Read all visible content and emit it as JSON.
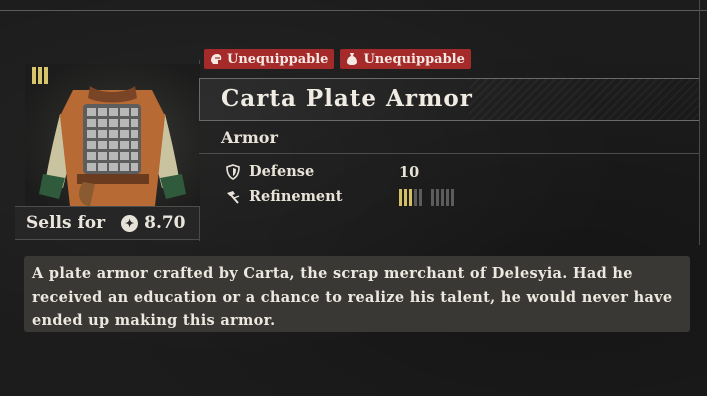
{
  "item": {
    "badges": [
      {
        "label": "Unequippable",
        "icon": "helmet-icon"
      },
      {
        "label": "Unequippable",
        "icon": "sack-icon"
      }
    ],
    "name": "Carta Plate Armor",
    "category": "Armor",
    "tier": 3,
    "stats": [
      {
        "label": "Defense",
        "value": "10",
        "icon": "shield-icon"
      },
      {
        "label": "Refinement",
        "icon": "hammer-icon",
        "level": 3,
        "max": 10
      }
    ],
    "sells_label": "Sells for",
    "price": "8.70",
    "description": "A plate armor crafted by Carta, the scrap merchant of Delesyia. Had he received an education or a chance to realize his talent, he would never have ended up making this armor."
  },
  "colors": {
    "badge": "#a52a2a",
    "tier": "#d6c56a",
    "refine_on": "#d4c063",
    "refine_off": "#5c5c5c"
  }
}
